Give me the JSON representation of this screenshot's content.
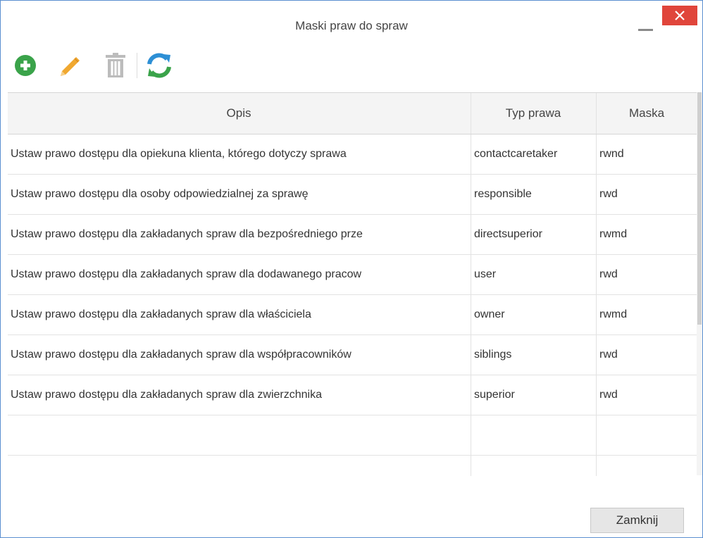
{
  "window": {
    "title": "Maski praw do spraw"
  },
  "toolbar": {
    "buttons": [
      {
        "name": "add",
        "icon": "plus-circle-icon",
        "color": "#3aa34a"
      },
      {
        "name": "edit",
        "icon": "pencil-icon",
        "color": "#f0a830"
      },
      {
        "name": "delete",
        "icon": "trash-icon",
        "color": "#bcbcbc"
      },
      {
        "name": "refresh",
        "icon": "refresh-icon",
        "colors": [
          "#2d8fd5",
          "#3aa34a"
        ]
      }
    ]
  },
  "table": {
    "columns": [
      "Opis",
      "Typ prawa",
      "Maska"
    ],
    "rows": [
      [
        "Ustaw prawo dostępu dla opiekuna klienta, którego dotyczy sprawa",
        "contactcaretaker",
        "rwnd"
      ],
      [
        "Ustaw prawo dostępu dla osoby odpowiedzialnej za sprawę",
        "responsible",
        "rwd"
      ],
      [
        "Ustaw prawo dostępu dla zakładanych spraw dla bezpośredniego prze",
        "directsuperior",
        "rwmd"
      ],
      [
        "Ustaw prawo dostępu dla zakładanych spraw dla dodawanego pracow",
        "user",
        "rwd"
      ],
      [
        "Ustaw prawo dostępu dla zakładanych spraw dla właściciela",
        "owner",
        "rwmd"
      ],
      [
        "Ustaw prawo dostępu dla zakładanych spraw dla współpracowników",
        "siblings",
        "rwd"
      ],
      [
        "Ustaw prawo dostępu dla zakładanych spraw dla zwierzchnika",
        "superior",
        "rwd"
      ],
      [
        "",
        "",
        ""
      ],
      [
        "",
        "",
        ""
      ]
    ]
  },
  "footer": {
    "close_label": "Zamknij"
  },
  "colors": {
    "close_button": "#e0453b",
    "border": "#5a8fd0"
  }
}
